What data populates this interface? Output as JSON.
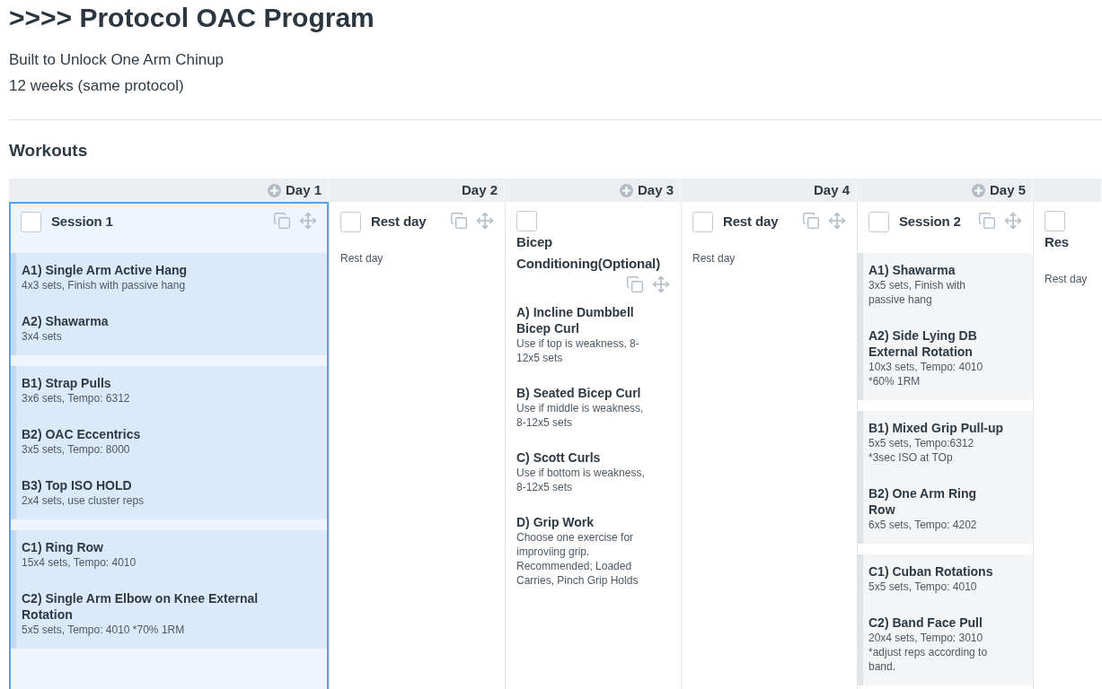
{
  "page": {
    "title": ">>>> Protocol OAC Program",
    "description": [
      "Built to Unlock One Arm Chinup",
      "12 weeks (same protocol)"
    ]
  },
  "section": {
    "title": "Workouts"
  },
  "days": [
    {
      "label": "Day 1",
      "add_icon": true,
      "selected": true,
      "card": {
        "kind": "workout",
        "title": "Session 1",
        "checked": false,
        "tools": true,
        "groups": [
          {
            "exercises": [
              {
                "name": "A1) Single Arm Active Hang",
                "details": "4x3 sets, Finish with passive hang"
              },
              {
                "name": "A2) Shawarma",
                "details": "3x4 sets"
              }
            ]
          },
          {
            "exercises": [
              {
                "name": "B1) Strap Pulls",
                "details": "3x6 sets, Tempo: 6312"
              },
              {
                "name": "B2) OAC Eccentrics",
                "details": "3x5 sets, Tempo: 8000"
              },
              {
                "name": "B3) Top ISO HOLD",
                "details": "2x4 sets, use cluster reps"
              }
            ]
          },
          {
            "exercises": [
              {
                "name": "C1) Ring Row",
                "details": "15x4 sets, Tempo: 4010"
              },
              {
                "name": "C2) Single Arm Elbow on Knee External Rotation",
                "details": "5x5 sets, Tempo: 4010 *70% 1RM"
              }
            ]
          }
        ]
      }
    },
    {
      "label": "Day 2",
      "add_icon": false,
      "selected": false,
      "card": {
        "kind": "rest",
        "title": "Rest day",
        "checked": false,
        "tools": true,
        "note": "Rest day"
      }
    },
    {
      "label": "Day 3",
      "add_icon": true,
      "selected": false,
      "card": {
        "kind": "list",
        "title": "Bicep Conditioning(Optional)",
        "checked": false,
        "tools": true,
        "exercises": [
          {
            "name": "A) Incline Dumbbell Bicep Curl",
            "details": "Use if top is weakness, 8-12x5 sets"
          },
          {
            "name": "B) Seated Bicep Curl",
            "details": "Use if middle is weakness, 8-12x5 sets"
          },
          {
            "name": "C) Scott Curls",
            "details": "Use if bottom is weakness, 8-12x5 sets"
          },
          {
            "name": "D) Grip Work",
            "details": "Choose one exercise for improviing grip. Recommended; Loaded Carries, Pinch Grip Holds"
          }
        ]
      }
    },
    {
      "label": "Day 4",
      "add_icon": false,
      "selected": false,
      "card": {
        "kind": "rest",
        "title": "Rest day",
        "checked": false,
        "tools": true,
        "note": "Rest day"
      }
    },
    {
      "label": "Day 5",
      "add_icon": true,
      "selected": false,
      "card": {
        "kind": "workout",
        "title": "Session 2",
        "checked": false,
        "tools": true,
        "groups": [
          {
            "exercises": [
              {
                "name": "A1) Shawarma",
                "details": "3x5 sets, Finish with passive hang"
              },
              {
                "name": "A2) Side Lying DB External Rotation",
                "details": "10x3 sets, Tempo: 4010 *60% 1RM"
              }
            ]
          },
          {
            "exercises": [
              {
                "name": "B1) Mixed Grip Pull-up",
                "details": "5x5 sets, Tempo:6312 *3sec ISO at TOp"
              },
              {
                "name": "B2) One Arm Ring Row",
                "details": "6x5 sets, Tempo: 4202"
              }
            ]
          },
          {
            "exercises": [
              {
                "name": "C1) Cuban Rotations",
                "details": "5x5 sets, Tempo: 4010"
              },
              {
                "name": "C2) Band Face Pull",
                "details": "20x4 sets, Tempo: 3010 *adjust reps according to band."
              }
            ]
          }
        ]
      }
    },
    {
      "add_icon": false,
      "selected": false,
      "card": {
        "kind": "rest",
        "title": "Res",
        "checked": false,
        "tools": false,
        "note": "Rest day"
      }
    }
  ]
}
